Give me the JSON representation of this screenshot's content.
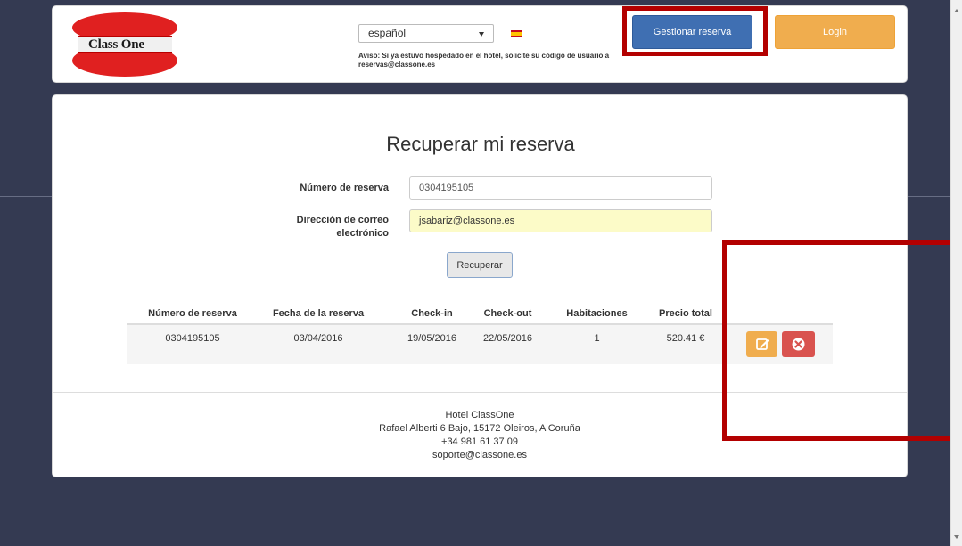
{
  "header": {
    "logo_text": "Class One",
    "language_value": "español",
    "notice": "Aviso: Si ya estuvo hospedado en el hotel, solicite su código de usuario a reservas@classone.es",
    "manage_button": "Gestionar reserva",
    "login_button": "Login"
  },
  "form": {
    "title": "Recuperar mi reserva",
    "booking_label": "Número de reserva",
    "booking_value": "0304195105",
    "email_label_1": "Dirección de correo",
    "email_label_2": "electrónico",
    "email_value": "jsabariz@classone.es",
    "submit_label": "Recuperar"
  },
  "table": {
    "headers": [
      "Número de reserva",
      "Fecha de la reserva",
      "Check-in",
      "Check-out",
      "Habitaciones",
      "Precio total"
    ],
    "rows": [
      [
        "0304195105",
        "03/04/2016",
        "19/05/2016",
        "22/05/2016",
        "1",
        "520.41 €"
      ]
    ]
  },
  "footer": {
    "name": "Hotel ClassOne",
    "address": "Rafael Alberti 6 Bajo, 15172 Oleiros, A Coruña",
    "phone": "+34 981 61 37 09",
    "email": "soporte@classone.es"
  },
  "colors": {
    "background": "#343a52",
    "primary": "#3f6fb2",
    "warning": "#f0ad4e",
    "danger": "#d9534f",
    "highlight": "#b30000"
  },
  "icons": [
    "edit-icon",
    "cancel-icon",
    "chevron-down-icon"
  ]
}
